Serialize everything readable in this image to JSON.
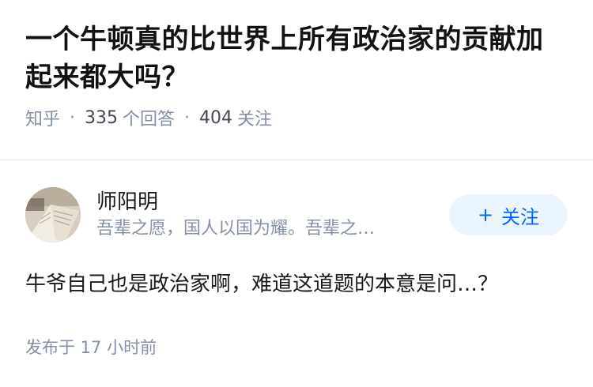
{
  "question": {
    "title": "一个牛顿真的比世界上所有政治家的贡献加起来都大吗？",
    "source": "知乎",
    "answers_count": "335",
    "answers_label": "个回答",
    "followers_count": "404",
    "followers_label": "关注"
  },
  "answer": {
    "author_name": "师阳明",
    "author_bio": "吾辈之愿，国人以国为耀。吾辈之…",
    "follow_label": "关注",
    "content": "牛爷自己也是政治家啊，难道这道题的本意是问…？",
    "published": "发布于 17 小时前"
  }
}
